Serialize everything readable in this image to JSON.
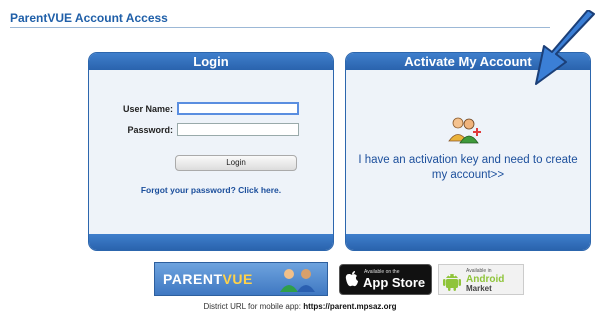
{
  "page": {
    "title": "ParentVUE Account Access"
  },
  "login_panel": {
    "header": "Login",
    "username_label": "User Name:",
    "password_label": "Password:",
    "login_button": "Login",
    "forgot_link": "Forgot your password? Click here."
  },
  "activate_panel": {
    "header": "Activate My Account",
    "link": "I have an activation key and need to create my account>>"
  },
  "badges": {
    "parentvue_prefix": "PARENT",
    "parentvue_suffix": "VUE",
    "appstore_small": "Available on the",
    "appstore_big": "App Store",
    "android_small": "Available in",
    "android_mid": "Android",
    "android_low": "Market"
  },
  "footer": {
    "district_label": "District URL for mobile app:",
    "district_url": "https://parent.mpsaz.org"
  },
  "colors": {
    "brand_blue": "#2a63ad",
    "link_blue": "#1c4f9c",
    "arrow_blue": "#3b7fd6",
    "android_green": "#8fc43a"
  },
  "icons": [
    "users-icon",
    "arrow-icon",
    "people-icon",
    "apple-icon",
    "android-robot-icon"
  ]
}
